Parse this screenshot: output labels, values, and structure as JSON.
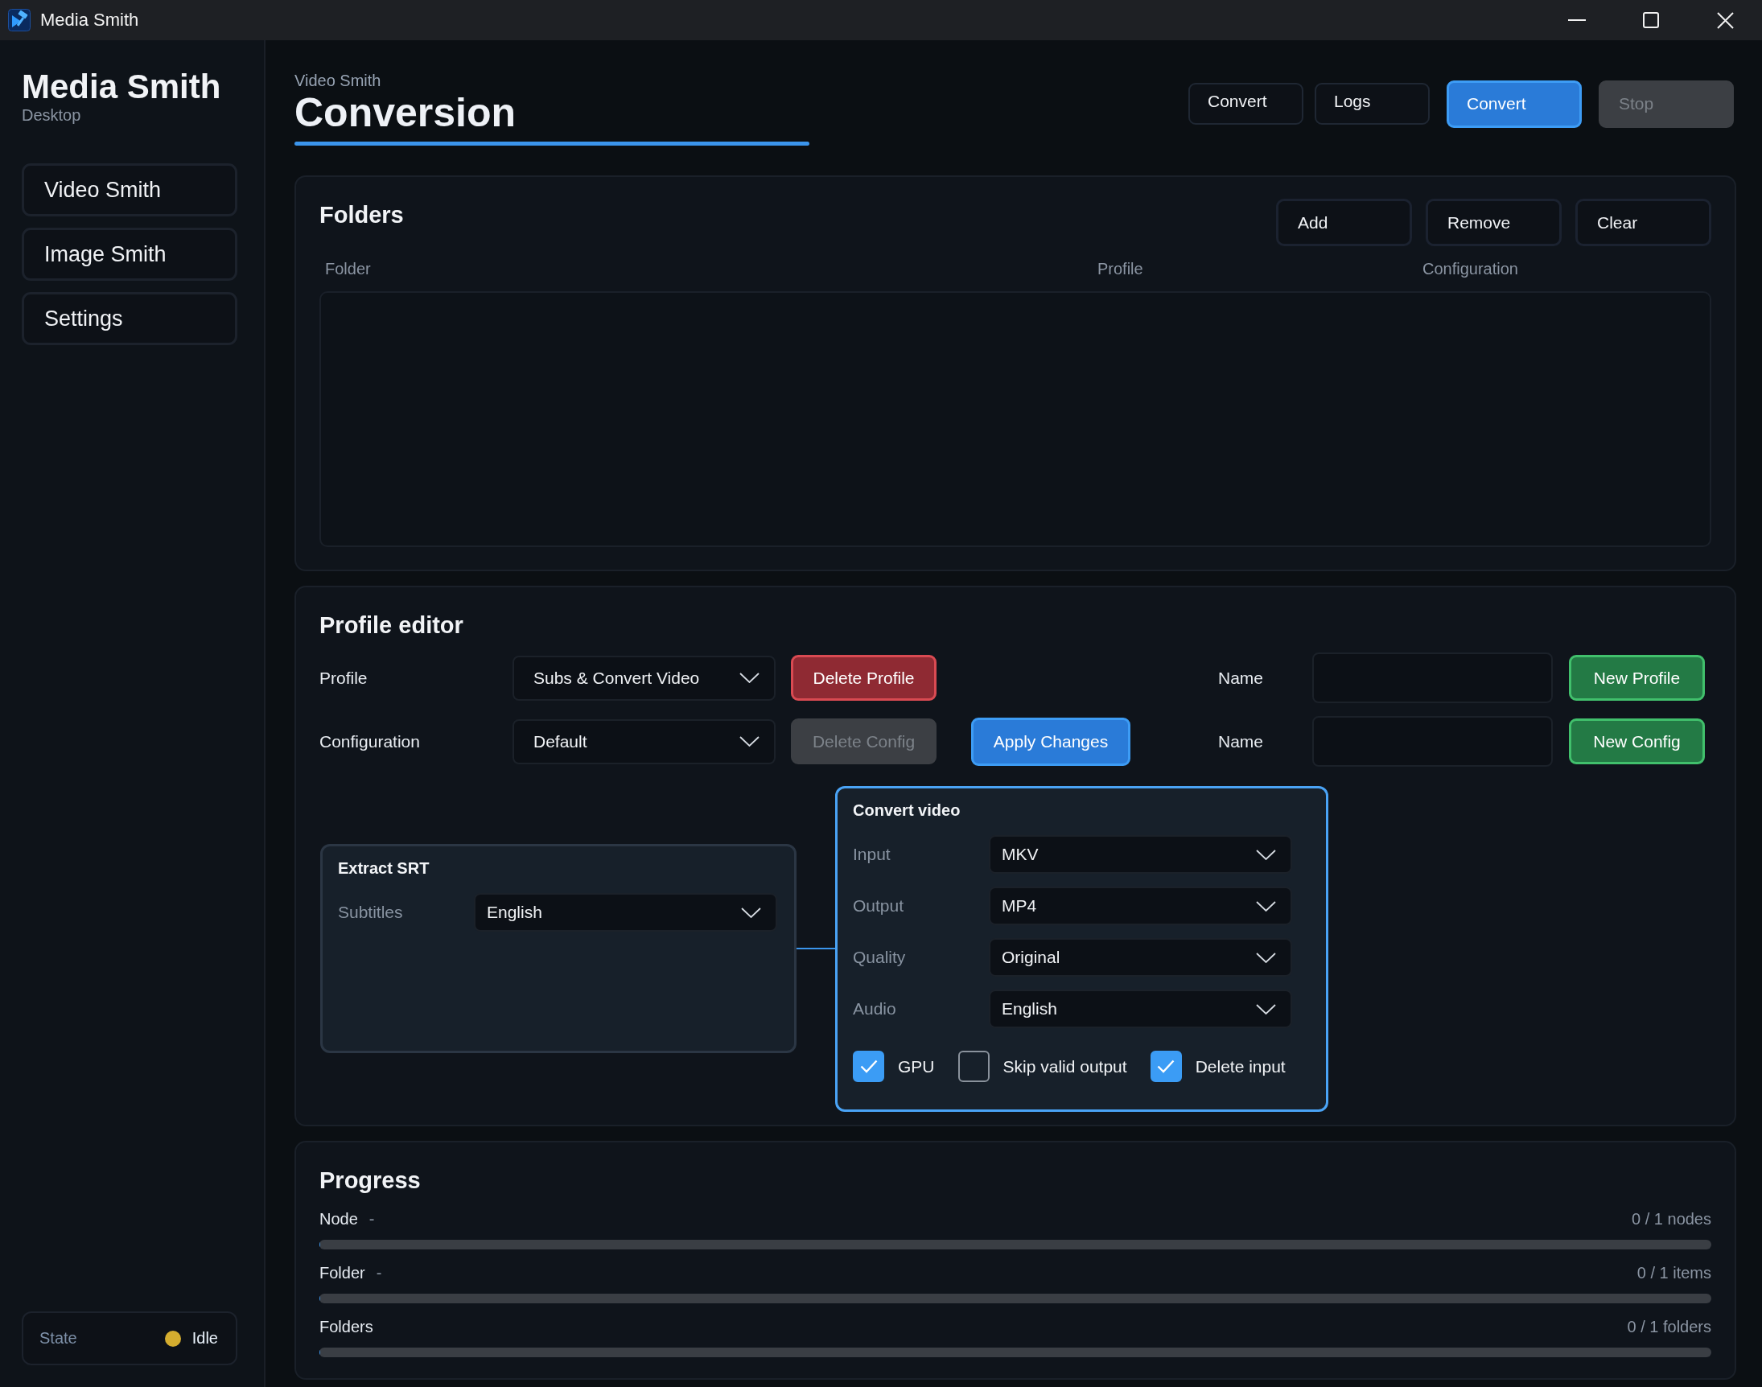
{
  "window": {
    "title": "Media Smith"
  },
  "sidebar": {
    "app_name": "Media Smith",
    "subtitle": "Desktop",
    "items": [
      "Video Smith",
      "Image Smith",
      "Settings"
    ],
    "state": {
      "label": "State",
      "value": "Idle",
      "color": "#d4ad2f"
    }
  },
  "header": {
    "breadcrumb": "Video Smith",
    "title": "Conversion",
    "buttons": [
      {
        "label": "Convert",
        "kind": "secondary",
        "disabled": false
      },
      {
        "label": "Logs",
        "kind": "secondary",
        "disabled": false
      },
      {
        "label": "Convert",
        "kind": "primary",
        "disabled": false
      },
      {
        "label": "Stop",
        "kind": "primary",
        "disabled": true
      }
    ]
  },
  "folders": {
    "title": "Folders",
    "buttons": [
      "Add",
      "Remove",
      "Clear"
    ],
    "table": {
      "columns": [
        "Folder",
        "Profile",
        "Configuration"
      ]
    }
  },
  "profile_editor": {
    "title": "Profile editor",
    "rows": [
      {
        "label": "Profile",
        "select": "Subs & Convert Video",
        "buttons": [
          {
            "label": "Delete Profile",
            "kind": "danger",
            "disabled": false
          }
        ],
        "name_label": "Name",
        "create_button": {
          "label": "New Profile",
          "kind": "success"
        }
      },
      {
        "label": "Configuration",
        "select": "Default",
        "buttons": [
          {
            "label": "Delete Config",
            "kind": "danger",
            "disabled": true
          },
          {
            "label": "Apply Changes",
            "kind": "primary",
            "disabled": false
          }
        ],
        "name_label": "Name",
        "create_button": {
          "label": "New Config",
          "kind": "success"
        }
      }
    ],
    "graph": {
      "nodes": [
        {
          "title": "Extract SRT",
          "selected": false,
          "fields": [
            {
              "label": "Subtitles",
              "value": "English"
            }
          ]
        },
        {
          "title": "Convert video",
          "selected": true,
          "fields": [
            {
              "label": "Input",
              "value": "MKV"
            },
            {
              "label": "Output",
              "value": "MP4"
            },
            {
              "label": "Quality",
              "value": "Original"
            },
            {
              "label": "Audio",
              "value": "English"
            }
          ],
          "options": [
            {
              "label": "GPU",
              "checked": true
            },
            {
              "label": "Skip valid output",
              "checked": false
            },
            {
              "label": "Delete input",
              "checked": true
            }
          ]
        }
      ]
    }
  },
  "progress": {
    "title": "Progress",
    "rows": [
      {
        "label": "Node",
        "detail": "-",
        "count": "0 / 1 nodes",
        "level": 0
      },
      {
        "label": "Folder",
        "detail": "-",
        "count": "0 / 1 items",
        "level": 0
      },
      {
        "label": "Folders",
        "count": "0 / 1 folders",
        "level": 0
      }
    ]
  }
}
